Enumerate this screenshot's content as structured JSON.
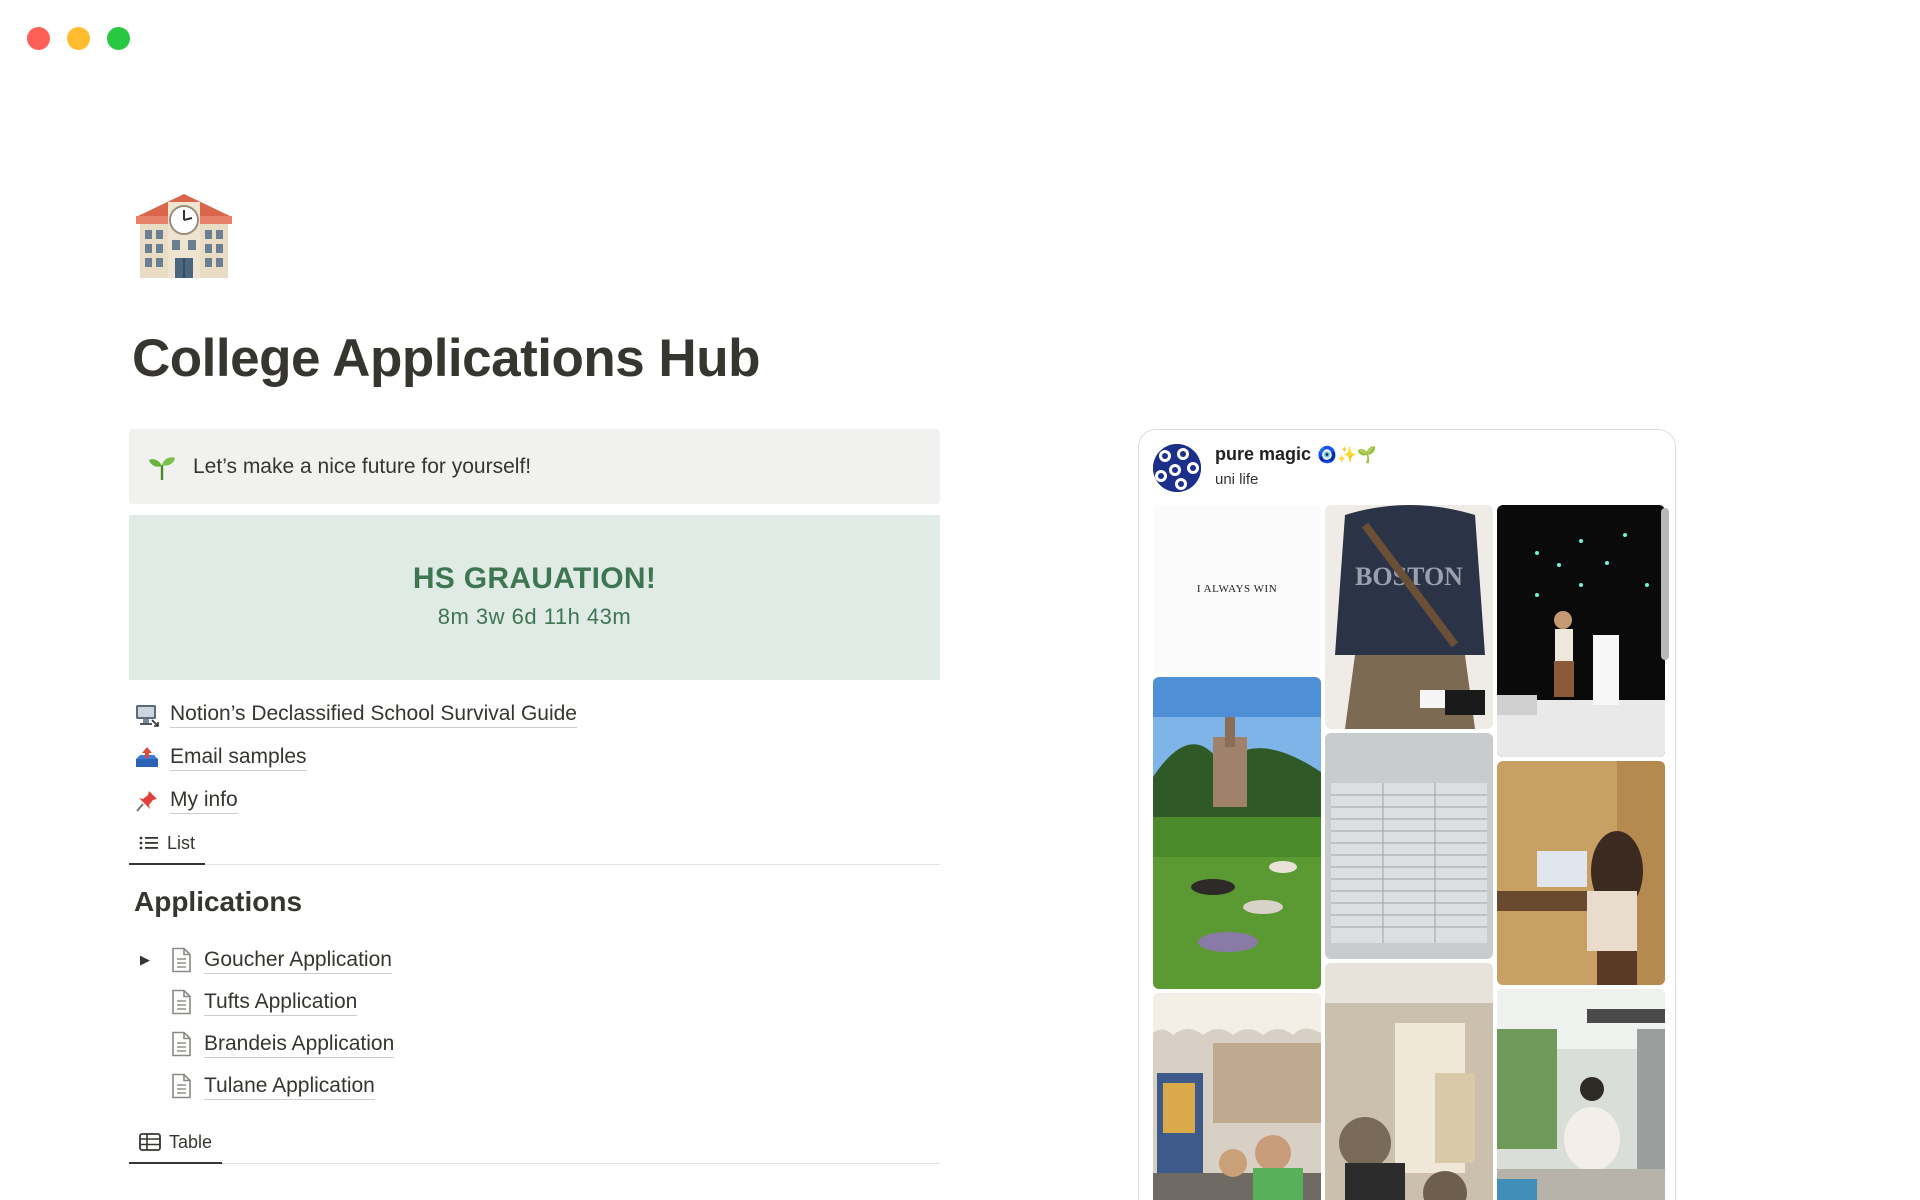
{
  "window": {
    "controls": [
      "close",
      "minimize",
      "zoom"
    ]
  },
  "page": {
    "icon": "school-building-icon",
    "title": "College Applications Hub"
  },
  "callout": {
    "icon": "seedling-icon",
    "text": "Let’s make a nice future for yourself!"
  },
  "countdown": {
    "heading": "HS GRAUATION!",
    "value": "8m 3w 6d 11h 43m",
    "bg_color": "#e0ebe6",
    "text_color": "#3f7652"
  },
  "links": [
    {
      "icon": "desktop-computer-icon",
      "label": "Notion’s Declassified School Survival Guide"
    },
    {
      "icon": "outbox-tray-icon",
      "label": "Email samples"
    },
    {
      "icon": "pushpin-icon",
      "label": "My info"
    }
  ],
  "view_tabs": {
    "list": "List",
    "table": "Table"
  },
  "applications": {
    "title": "Applications",
    "items": [
      {
        "label": "Goucher Application",
        "expandable": true
      },
      {
        "label": "Tufts Application",
        "expandable": false
      },
      {
        "label": "Brandeis Application",
        "expandable": false
      },
      {
        "label": "Tulane Application",
        "expandable": false
      }
    ]
  },
  "embed": {
    "board_name": "pure magic",
    "board_emoji": "🧿✨🌱",
    "board_subtitle": "uni life",
    "pin1_text": "I ALWAYS WIN"
  }
}
